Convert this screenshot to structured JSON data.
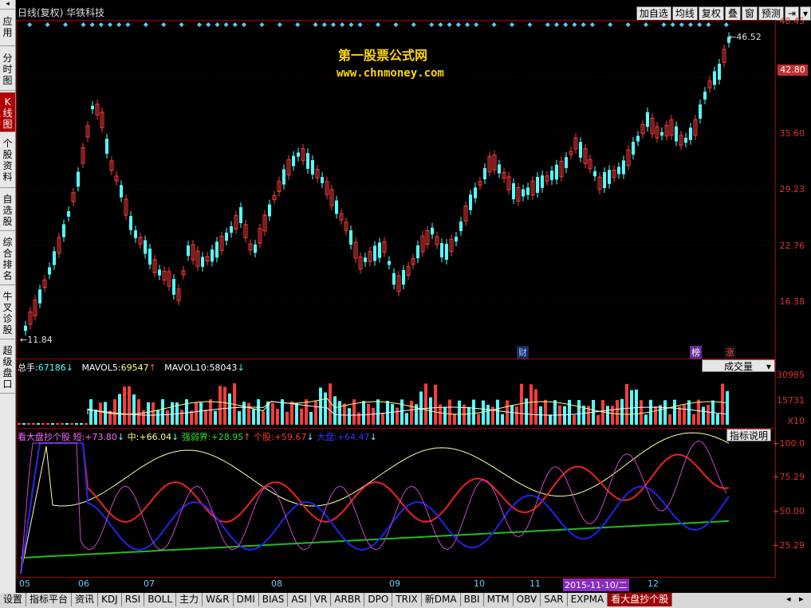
{
  "sidebar": {
    "items": [
      {
        "label": "应用"
      },
      {
        "label": "分时图"
      },
      {
        "label": "K线图"
      },
      {
        "label": "个股资料"
      },
      {
        "label": "自选股"
      },
      {
        "label": "综合排名"
      },
      {
        "label": "牛叉诊股"
      },
      {
        "label": "超级盘口"
      }
    ]
  },
  "header": {
    "title": "日线(复权) 华铁科技",
    "toolbar": [
      "加自选",
      "均线",
      "复权",
      "叠",
      "窗",
      "预测"
    ]
  },
  "watermark": {
    "line1": "第一股票公式网",
    "line2": "www.chnmoney.com"
  },
  "price_axis": {
    "labels": [
      "48.45",
      "42.80",
      "35.60",
      "29.23",
      "22.76",
      "16.38"
    ],
    "current_price": "42.80",
    "high_marker": "46.52",
    "low_marker": "11.84"
  },
  "markers": {
    "cai": "财",
    "bang": "榜",
    "zhang": "涨"
  },
  "volume_panel": {
    "total_label": "总手:",
    "total_value": "67186",
    "mavol5_label": "MAVOL5:",
    "mavol5_value": "69547",
    "mavol10_label": "MAVOL10:",
    "mavol10_value": "58043",
    "dropdown": "成交量",
    "axis": [
      "30985",
      "15731",
      "X10"
    ]
  },
  "indicator_panel": {
    "name": "看大盘抄个股",
    "short_label": "短:",
    "short_value": "+73.80",
    "mid_label": "中:",
    "mid_value": "+66.04",
    "strong_label": "强弱界:",
    "strong_value": "+28.95",
    "stock_label": "个股:",
    "stock_value": "+59.67",
    "market_label": "大盘:",
    "market_value": "+64.47",
    "help_button": "指标说明",
    "axis": [
      "+100.0",
      "+75.29",
      "+50.00",
      "+25.29"
    ]
  },
  "x_axis": {
    "months": [
      "05",
      "06",
      "07",
      "08",
      "09",
      "10",
      "11",
      "12"
    ],
    "cursor_date": "2015-11-10/二"
  },
  "bottom_tabs": [
    "设置",
    "指标平台",
    "资讯",
    "KDJ",
    "RSI",
    "BOLL",
    "主力",
    "W&R",
    "DMI",
    "BIAS",
    "ASI",
    "VR",
    "ARBR",
    "DPO",
    "TRIX",
    "新DMA",
    "BBI",
    "MTM",
    "OBV",
    "SAR",
    "EXPMA",
    "看大盘抄个股"
  ],
  "colors": {
    "up": "#ff3b3b",
    "down": "#54ffff",
    "border": "#a00000",
    "accent": "#ffd700"
  }
}
